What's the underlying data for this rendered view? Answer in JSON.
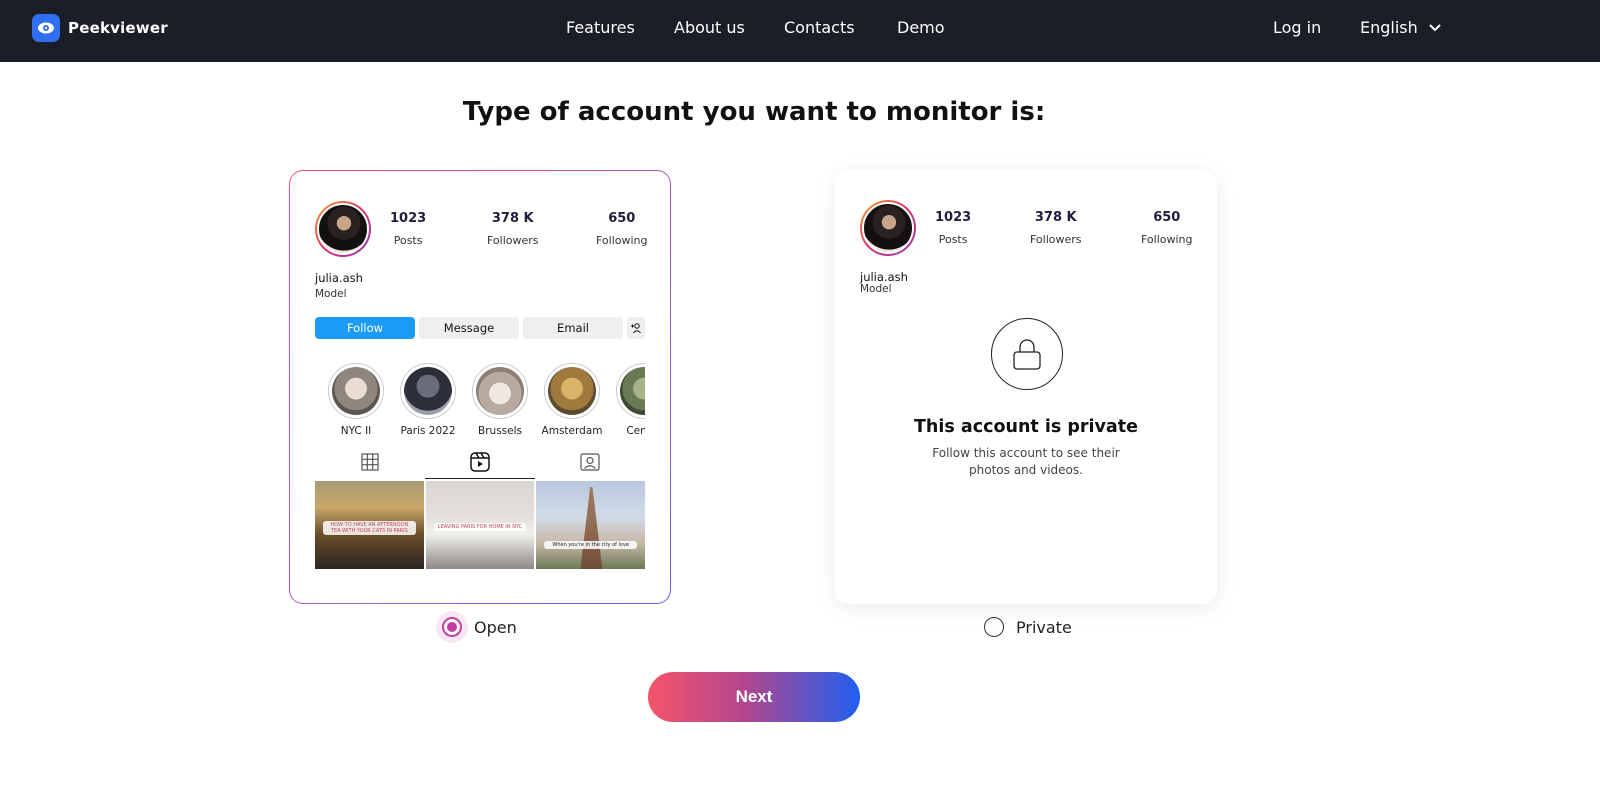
{
  "nav": {
    "brand": "Peekviewer",
    "links": [
      "Features",
      "About us",
      "Contacts",
      "Demo"
    ],
    "login": "Log in",
    "language": "English"
  },
  "heading": "Type of account you want to monitor is:",
  "open_card": {
    "stats": [
      {
        "value": "1023",
        "label": "Posts"
      },
      {
        "value": "378 K",
        "label": "Followers"
      },
      {
        "value": "650",
        "label": "Following"
      }
    ],
    "username": "julia.ash",
    "role": "Model",
    "buttons": {
      "follow": "Follow",
      "message": "Message",
      "email": "Email"
    },
    "highlights": [
      "NYC II",
      "Paris 2022",
      "Brussels",
      "Amsterdam",
      "Centra"
    ],
    "posts": [
      {
        "caption": "HOW TO HAVE AN AFTERNOON TEA WITH YOUR CATS IN PARIS"
      },
      {
        "caption": "LEAVING PARIS FOR HOME IN NYC"
      },
      {
        "caption": "When you're in the city of love"
      }
    ]
  },
  "private_card": {
    "stats": [
      {
        "value": "1023",
        "label": "Posts"
      },
      {
        "value": "378 K",
        "label": "Followers"
      },
      {
        "value": "650",
        "label": "Following"
      }
    ],
    "username": "julia.ash",
    "role": "Model",
    "title": "This account is private",
    "subtitle": "Follow this account to see their photos and videos."
  },
  "options": {
    "open": "Open",
    "private": "Private",
    "selected": "open"
  },
  "next_button": "Next",
  "colors": {
    "nav_bg": "#1b1e27",
    "brand_blue": "#2f6ff0",
    "radio_accent": "#c23fa6",
    "ig_blue": "#1a9bf5"
  }
}
